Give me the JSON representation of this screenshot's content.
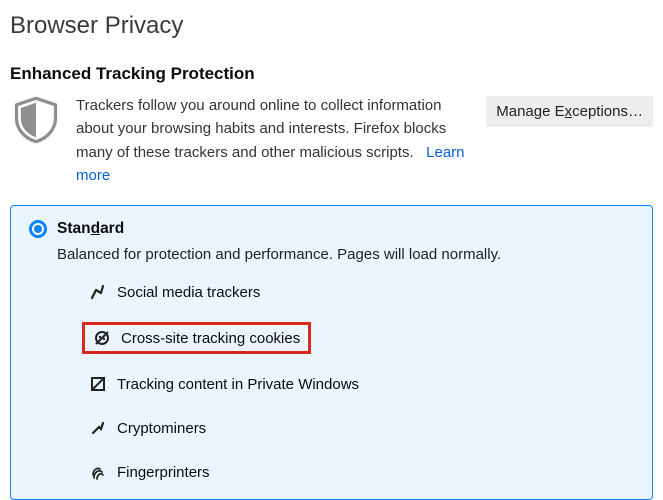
{
  "heading": "Browser Privacy",
  "section_title": "Enhanced Tracking Protection",
  "intro_text": "Trackers follow you around online to collect information about your browsing habits and interests. Firefox blocks many of these trackers and other malicious scripts.",
  "learn_more_label": "Learn more",
  "manage_exceptions_prefix": "Manage E",
  "manage_exceptions_hotkey": "x",
  "manage_exceptions_suffix": "ceptions…",
  "option": {
    "label_prefix": "Stan",
    "label_hotkey": "d",
    "label_suffix": "ard",
    "description": "Balanced for protection and performance. Pages will load normally."
  },
  "trackers": [
    {
      "icon": "social",
      "label": "Social media trackers",
      "highlight": false
    },
    {
      "icon": "cookie",
      "label": "Cross-site tracking cookies",
      "highlight": true
    },
    {
      "icon": "content",
      "label": "Tracking content in Private Windows",
      "highlight": false
    },
    {
      "icon": "crypto",
      "label": "Cryptominers",
      "highlight": false
    },
    {
      "icon": "finger",
      "label": "Fingerprinters",
      "highlight": false
    }
  ]
}
